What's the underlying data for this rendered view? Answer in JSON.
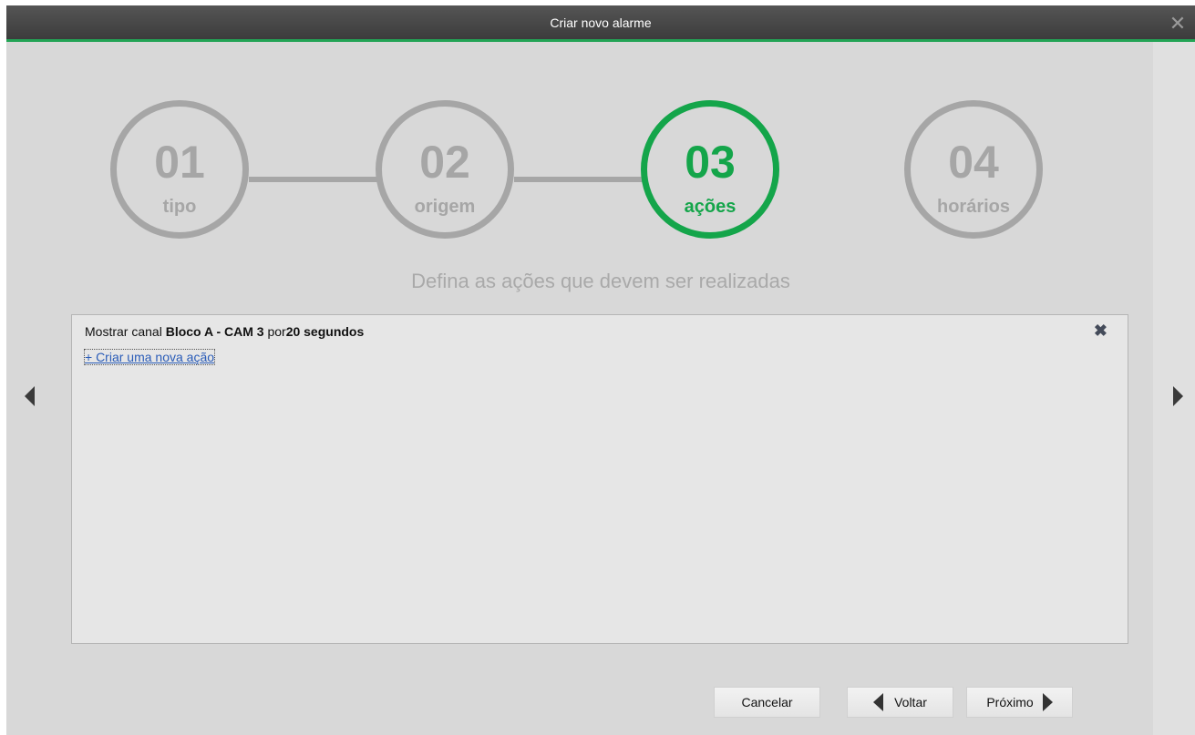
{
  "window": {
    "title": "Criar novo alarme",
    "close_symbol": "✕"
  },
  "stepper": {
    "steps": [
      {
        "number": "01",
        "label": "tipo",
        "active": false
      },
      {
        "number": "02",
        "label": "origem",
        "active": false
      },
      {
        "number": "03",
        "label": "ações",
        "active": true
      },
      {
        "number": "04",
        "label": "horários",
        "active": false
      }
    ],
    "subtitle": "Defina as ações que devem ser realizadas"
  },
  "actions": {
    "items": [
      {
        "prefix": "Mostrar canal",
        "channel": "Bloco A - CAM 3",
        "middle": "por",
        "duration": "20 segundos"
      }
    ],
    "remove_symbol": "✖",
    "new_action_label": "+ Criar uma nova ação"
  },
  "footer": {
    "cancel_label": "Cancelar",
    "back_label": "Voltar",
    "next_label": "Próximo"
  },
  "colors": {
    "accent": "#14a54a",
    "inactive": "#a6a6a6",
    "link": "#2a5cb8"
  },
  "icons": {
    "close": "close-icon",
    "remove": "remove-action-icon",
    "prev": "chevron-left-icon",
    "next": "chevron-right-icon"
  }
}
